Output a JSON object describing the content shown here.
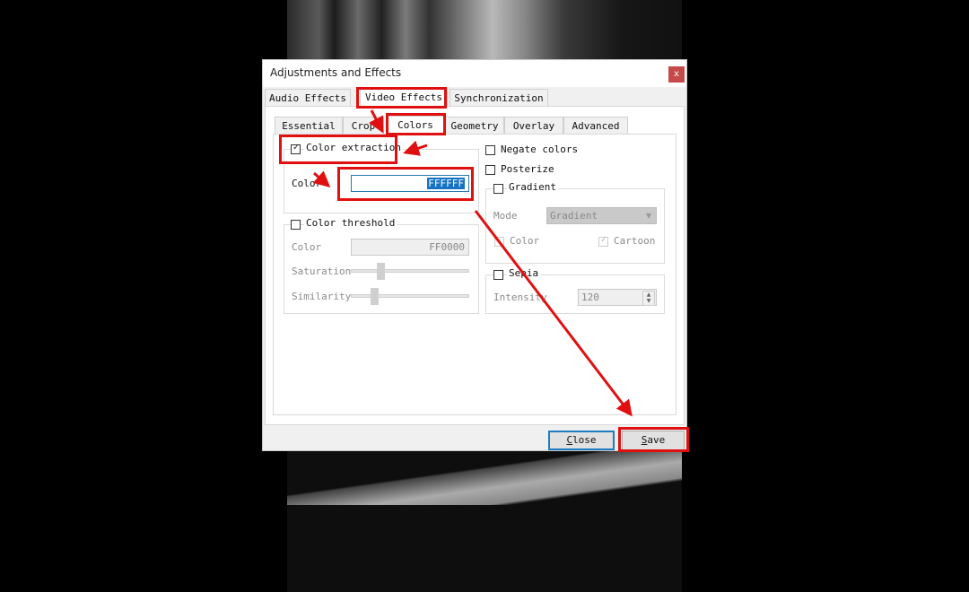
{
  "dialog": {
    "title": "Adjustments and Effects",
    "close_icon": "close-icon"
  },
  "main_tabs": [
    {
      "label": "Audio Effects",
      "active": false
    },
    {
      "label": "Video Effects",
      "active": true
    },
    {
      "label": "Synchronization",
      "active": false
    }
  ],
  "sub_tabs": [
    {
      "label": "Essential",
      "active": false
    },
    {
      "label": "Crop",
      "active": false
    },
    {
      "label": "Colors",
      "active": true
    },
    {
      "label": "Geometry",
      "active": false
    },
    {
      "label": "Overlay",
      "active": false
    },
    {
      "label": "Advanced",
      "active": false
    }
  ],
  "color_extraction": {
    "label": "Color extraction",
    "checked": true,
    "color_label": "Color",
    "color_value": "FFFFFF"
  },
  "color_threshold": {
    "label": "Color threshold",
    "checked": false,
    "color_label": "Color",
    "color_value": "FF0000",
    "saturation_label": "Saturation",
    "saturation_value_pct": 23,
    "similarity_label": "Similarity",
    "similarity_value_pct": 17
  },
  "negate_colors": {
    "label": "Negate colors",
    "checked": false
  },
  "posterize": {
    "label": "Posterize",
    "checked": false
  },
  "gradient": {
    "label": "Gradient",
    "checked": false,
    "mode_label": "Mode",
    "mode_value": "Gradient",
    "color_label": "Color",
    "color_checked": false,
    "cartoon_label": "Cartoon",
    "cartoon_checked": true
  },
  "sepia": {
    "label": "Sepia",
    "checked": false,
    "intensity_label": "Intensity",
    "intensity_value": "120"
  },
  "buttons": {
    "close": "Close",
    "close_mnemonic": "C",
    "close_rest": "lose",
    "save": "Save",
    "save_mnemonic": "S",
    "save_rest": "ave"
  },
  "annotation_color": "#e01010",
  "check_glyph": "✓"
}
